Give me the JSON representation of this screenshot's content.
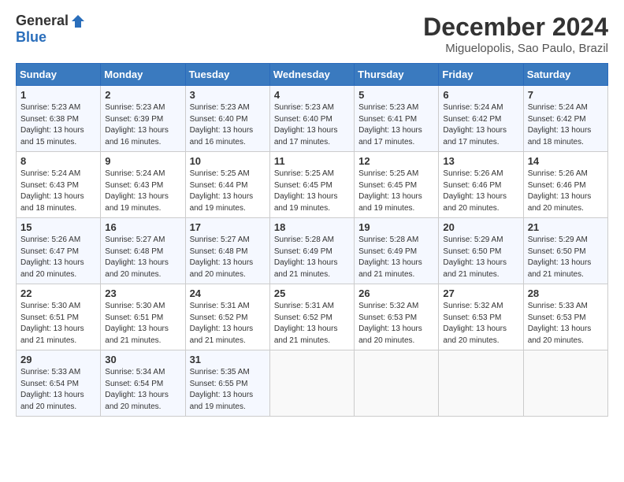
{
  "logo": {
    "general": "General",
    "blue": "Blue"
  },
  "title": "December 2024",
  "subtitle": "Miguelopolis, Sao Paulo, Brazil",
  "days_header": [
    "Sunday",
    "Monday",
    "Tuesday",
    "Wednesday",
    "Thursday",
    "Friday",
    "Saturday"
  ],
  "weeks": [
    [
      {
        "day": "1",
        "info": "Sunrise: 5:23 AM\nSunset: 6:38 PM\nDaylight: 13 hours\nand 15 minutes."
      },
      {
        "day": "2",
        "info": "Sunrise: 5:23 AM\nSunset: 6:39 PM\nDaylight: 13 hours\nand 16 minutes."
      },
      {
        "day": "3",
        "info": "Sunrise: 5:23 AM\nSunset: 6:40 PM\nDaylight: 13 hours\nand 16 minutes."
      },
      {
        "day": "4",
        "info": "Sunrise: 5:23 AM\nSunset: 6:40 PM\nDaylight: 13 hours\nand 17 minutes."
      },
      {
        "day": "5",
        "info": "Sunrise: 5:23 AM\nSunset: 6:41 PM\nDaylight: 13 hours\nand 17 minutes."
      },
      {
        "day": "6",
        "info": "Sunrise: 5:24 AM\nSunset: 6:42 PM\nDaylight: 13 hours\nand 17 minutes."
      },
      {
        "day": "7",
        "info": "Sunrise: 5:24 AM\nSunset: 6:42 PM\nDaylight: 13 hours\nand 18 minutes."
      }
    ],
    [
      {
        "day": "8",
        "info": "Sunrise: 5:24 AM\nSunset: 6:43 PM\nDaylight: 13 hours\nand 18 minutes."
      },
      {
        "day": "9",
        "info": "Sunrise: 5:24 AM\nSunset: 6:43 PM\nDaylight: 13 hours\nand 19 minutes."
      },
      {
        "day": "10",
        "info": "Sunrise: 5:25 AM\nSunset: 6:44 PM\nDaylight: 13 hours\nand 19 minutes."
      },
      {
        "day": "11",
        "info": "Sunrise: 5:25 AM\nSunset: 6:45 PM\nDaylight: 13 hours\nand 19 minutes."
      },
      {
        "day": "12",
        "info": "Sunrise: 5:25 AM\nSunset: 6:45 PM\nDaylight: 13 hours\nand 19 minutes."
      },
      {
        "day": "13",
        "info": "Sunrise: 5:26 AM\nSunset: 6:46 PM\nDaylight: 13 hours\nand 20 minutes."
      },
      {
        "day": "14",
        "info": "Sunrise: 5:26 AM\nSunset: 6:46 PM\nDaylight: 13 hours\nand 20 minutes."
      }
    ],
    [
      {
        "day": "15",
        "info": "Sunrise: 5:26 AM\nSunset: 6:47 PM\nDaylight: 13 hours\nand 20 minutes."
      },
      {
        "day": "16",
        "info": "Sunrise: 5:27 AM\nSunset: 6:48 PM\nDaylight: 13 hours\nand 20 minutes."
      },
      {
        "day": "17",
        "info": "Sunrise: 5:27 AM\nSunset: 6:48 PM\nDaylight: 13 hours\nand 20 minutes."
      },
      {
        "day": "18",
        "info": "Sunrise: 5:28 AM\nSunset: 6:49 PM\nDaylight: 13 hours\nand 21 minutes."
      },
      {
        "day": "19",
        "info": "Sunrise: 5:28 AM\nSunset: 6:49 PM\nDaylight: 13 hours\nand 21 minutes."
      },
      {
        "day": "20",
        "info": "Sunrise: 5:29 AM\nSunset: 6:50 PM\nDaylight: 13 hours\nand 21 minutes."
      },
      {
        "day": "21",
        "info": "Sunrise: 5:29 AM\nSunset: 6:50 PM\nDaylight: 13 hours\nand 21 minutes."
      }
    ],
    [
      {
        "day": "22",
        "info": "Sunrise: 5:30 AM\nSunset: 6:51 PM\nDaylight: 13 hours\nand 21 minutes."
      },
      {
        "day": "23",
        "info": "Sunrise: 5:30 AM\nSunset: 6:51 PM\nDaylight: 13 hours\nand 21 minutes."
      },
      {
        "day": "24",
        "info": "Sunrise: 5:31 AM\nSunset: 6:52 PM\nDaylight: 13 hours\nand 21 minutes."
      },
      {
        "day": "25",
        "info": "Sunrise: 5:31 AM\nSunset: 6:52 PM\nDaylight: 13 hours\nand 21 minutes."
      },
      {
        "day": "26",
        "info": "Sunrise: 5:32 AM\nSunset: 6:53 PM\nDaylight: 13 hours\nand 20 minutes."
      },
      {
        "day": "27",
        "info": "Sunrise: 5:32 AM\nSunset: 6:53 PM\nDaylight: 13 hours\nand 20 minutes."
      },
      {
        "day": "28",
        "info": "Sunrise: 5:33 AM\nSunset: 6:53 PM\nDaylight: 13 hours\nand 20 minutes."
      }
    ],
    [
      {
        "day": "29",
        "info": "Sunrise: 5:33 AM\nSunset: 6:54 PM\nDaylight: 13 hours\nand 20 minutes."
      },
      {
        "day": "30",
        "info": "Sunrise: 5:34 AM\nSunset: 6:54 PM\nDaylight: 13 hours\nand 20 minutes."
      },
      {
        "day": "31",
        "info": "Sunrise: 5:35 AM\nSunset: 6:55 PM\nDaylight: 13 hours\nand 19 minutes."
      },
      {
        "day": "",
        "info": ""
      },
      {
        "day": "",
        "info": ""
      },
      {
        "day": "",
        "info": ""
      },
      {
        "day": "",
        "info": ""
      }
    ]
  ]
}
